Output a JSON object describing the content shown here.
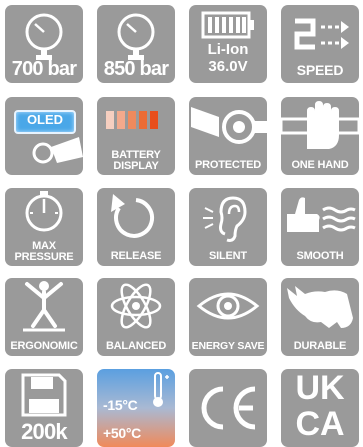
{
  "tiles": {
    "t700": {
      "label": "700 bar",
      "icon": "pressure-gauge-icon"
    },
    "t850": {
      "label": "850 bar",
      "icon": "pressure-gauge-icon"
    },
    "liion": {
      "line1": "Li-Ion",
      "line2": "36.0V",
      "icon": "battery-icon"
    },
    "speed": {
      "label": "SPEED",
      "digit": "2",
      "icon": "two-speed-icon"
    },
    "oled": {
      "screen": "OLED",
      "icon": "oled-display-icon",
      "screen_color": "#4aa7e8"
    },
    "battery_display": {
      "line1": "BATTERY",
      "line2": "DISPLAY",
      "icon": "battery-level-icon",
      "bar_colors": [
        "#f6cfc0",
        "#f3a98c",
        "#ef8a5d",
        "#ec6c35",
        "#e84e1b"
      ]
    },
    "protected": {
      "label": "PROTECTED",
      "icon": "protected-trigger-icon"
    },
    "one_hand": {
      "label": "ONE HAND",
      "icon": "one-hand-icon"
    },
    "max_pressure": {
      "line1": "MAX",
      "line2": "PRESSURE",
      "icon": "stopwatch-icon"
    },
    "release": {
      "label": "RELEASE",
      "icon": "release-arrow-icon"
    },
    "silent": {
      "label": "SILENT",
      "icon": "ear-icon"
    },
    "smooth": {
      "label": "SMOOTH",
      "icon": "smooth-hand-icon"
    },
    "ergonomic": {
      "label": "ERGONOMIC",
      "icon": "ergonomic-figure-icon"
    },
    "balanced": {
      "label": "BALANCED",
      "icon": "atom-icon"
    },
    "energy_save": {
      "label": "ENERGY SAVE",
      "icon": "eye-icon"
    },
    "durable": {
      "label": "DURABLE",
      "icon": "rhino-icon"
    },
    "memory": {
      "label": "200k",
      "icon": "floppy-disk-icon"
    },
    "temperature": {
      "low": "-15°C",
      "high": "+50°C",
      "icon": "thermometer-icon",
      "gradient_top": "#5b9fe0",
      "gradient_bottom": "#f08a5a"
    },
    "ce": {
      "label": "CE",
      "icon": "ce-mark-icon"
    },
    "ukca": {
      "line1": "UK",
      "line2": "CA",
      "icon": "ukca-mark-icon"
    }
  },
  "colors": {
    "tile_bg": "#9a9a9a",
    "icon_fg": "#ffffff"
  }
}
